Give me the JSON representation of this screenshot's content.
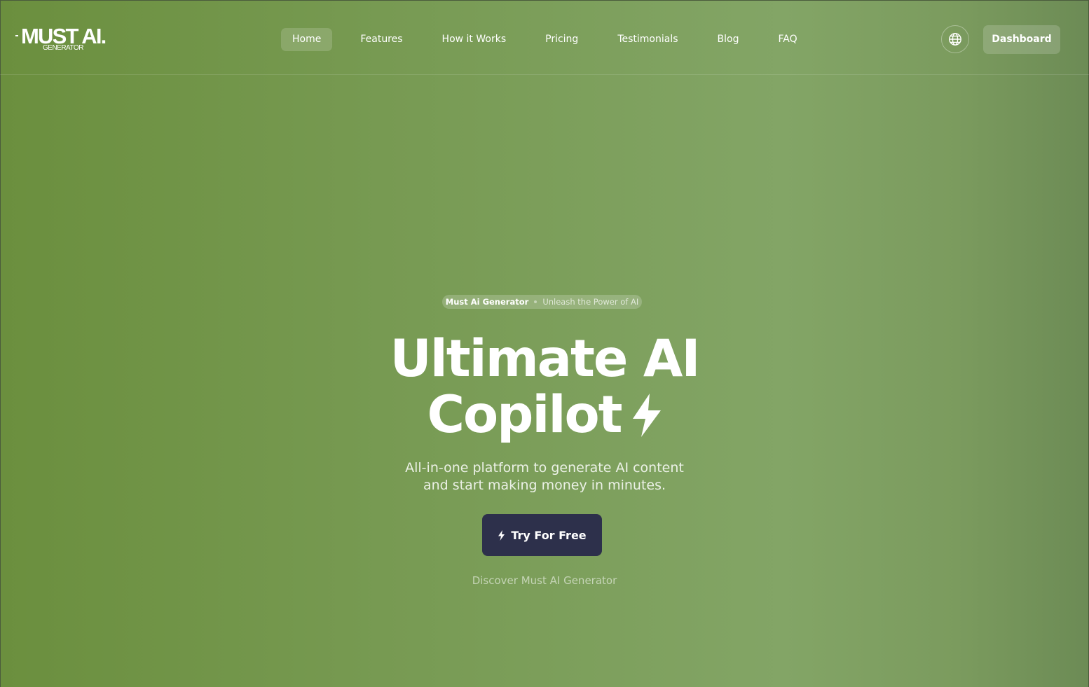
{
  "brand": {
    "logo_text": "MUST AI.",
    "logo_subtext": "GENERATOR"
  },
  "nav": {
    "items": [
      {
        "label": "Home",
        "active": true
      },
      {
        "label": "Features"
      },
      {
        "label": "How it Works"
      },
      {
        "label": "Pricing"
      },
      {
        "label": "Testimonials"
      },
      {
        "label": "Blog"
      },
      {
        "label": "FAQ"
      }
    ]
  },
  "header_actions": {
    "language_icon": "globe-icon",
    "dashboard_label": "Dashboard"
  },
  "hero": {
    "pill_brand": "Must Ai Generator",
    "pill_tagline": "Unleash the Power of AI",
    "headline_line1": "Ultimate AI",
    "headline_line2": "Copilot",
    "headline_icon": "lightning-bolt-icon",
    "subtitle_line1": "All-in-one platform to generate AI content",
    "subtitle_line2": "and start making money in minutes.",
    "cta_label": "Try For Free",
    "cta_icon": "lightning-bolt-icon",
    "discover_link": "Discover Must AI Generator"
  },
  "colors": {
    "background_left": "#6b8f3e",
    "background_right": "#83a566",
    "cta_background": "#2d304b"
  }
}
